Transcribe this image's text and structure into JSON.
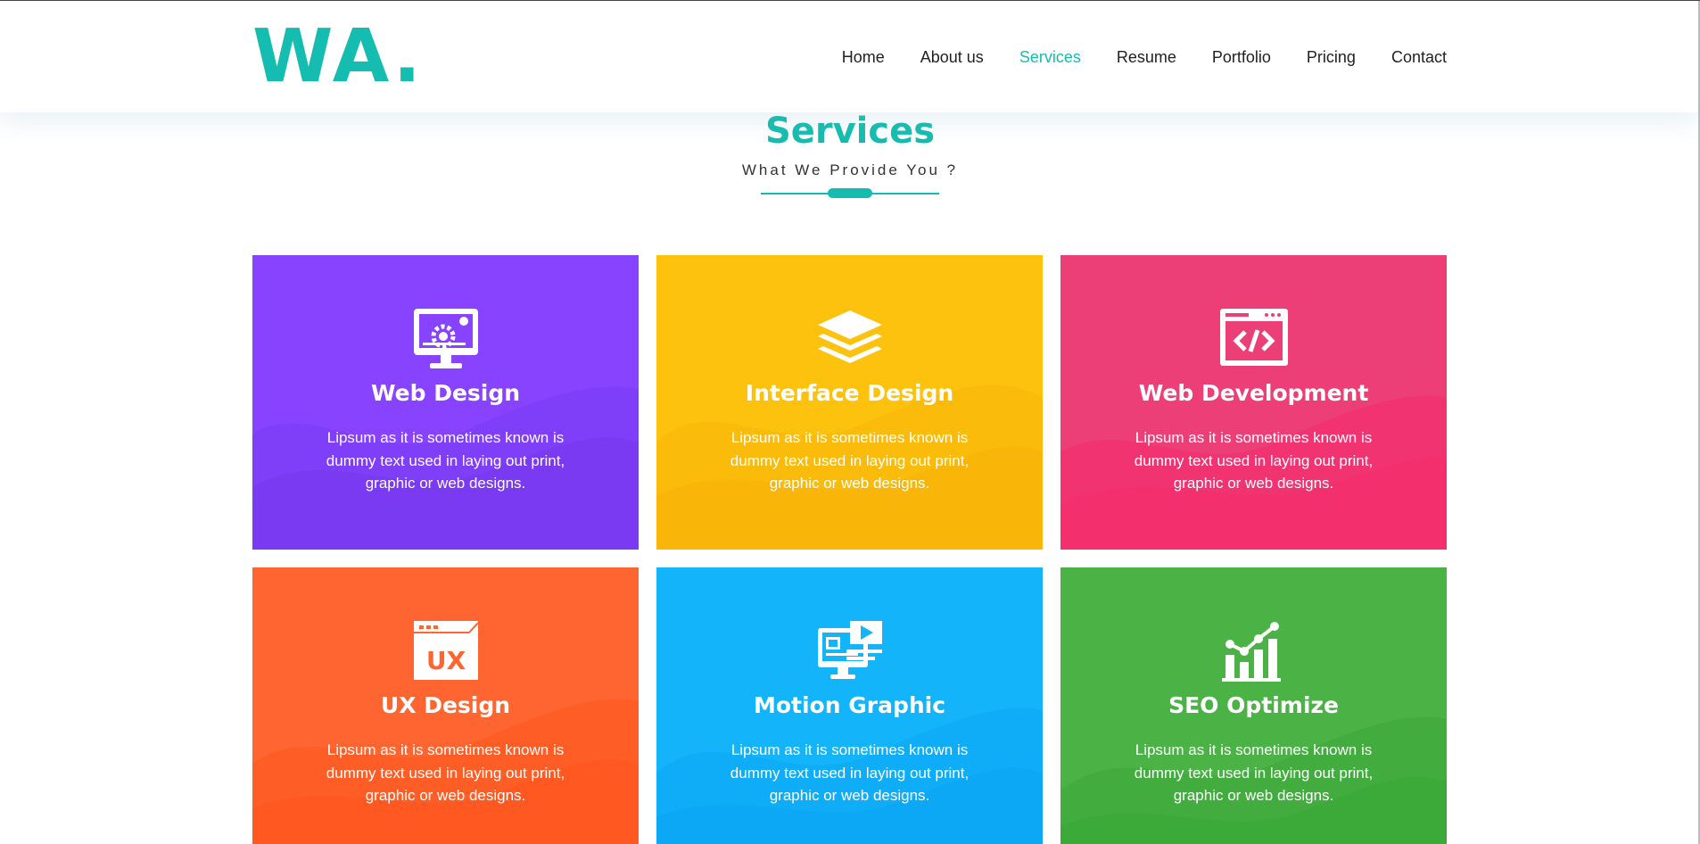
{
  "header": {
    "logo": "WA.",
    "nav": [
      "Home",
      "About us",
      "Services",
      "Resume",
      "Portfolio",
      "Pricing",
      "Contact"
    ],
    "active_nav": "Services"
  },
  "section": {
    "title": "Services",
    "subtitle": "What We Provide You ?"
  },
  "services": [
    {
      "title": "Web Design",
      "description": "Lipsum as it is sometimes known is dummy text used in laying out print, graphic or web designs.",
      "icon": "monitor-gear-icon",
      "color": "#8743ff"
    },
    {
      "title": "Interface Design",
      "description": "Lipsum as it is sometimes known is dummy text used in laying out print, graphic or web designs.",
      "icon": "layers-icon",
      "color": "#fdc20d"
    },
    {
      "title": "Web Development",
      "description": "Lipsum as it is sometimes known is dummy text used in laying out print, graphic or web designs.",
      "icon": "code-window-icon",
      "color": "#ec3f78"
    },
    {
      "title": "UX Design",
      "description": "Lipsum as it is sometimes known is dummy text used in laying out print, graphic or web designs.",
      "icon": "ux-window-icon",
      "color": "#ff6530"
    },
    {
      "title": "Motion Graphic",
      "description": "Lipsum as it is sometimes known is dummy text used in laying out print, graphic or web designs.",
      "icon": "video-monitor-icon",
      "color": "#14b4fb"
    },
    {
      "title": "SEO Optimize",
      "description": "Lipsum as it is sometimes known is dummy text used in laying out print, graphic or web designs.",
      "icon": "bar-chart-icon",
      "color": "#4bb246"
    }
  ],
  "colors": {
    "accent": "#14bdb0",
    "nav_text": "#222222"
  }
}
